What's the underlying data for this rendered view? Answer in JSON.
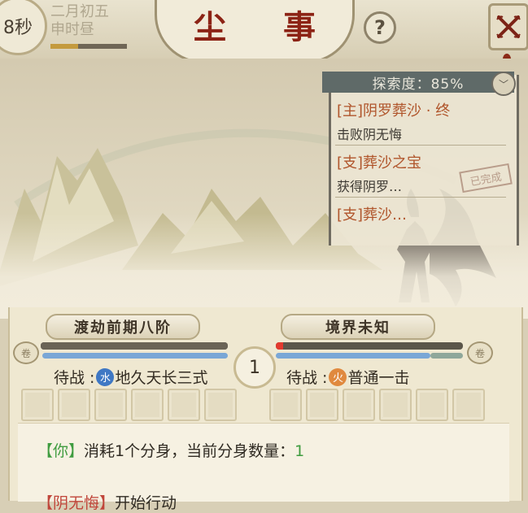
{
  "header": {
    "timer": "8秒",
    "date_line1": "二月初五",
    "date_line2": "申时昼",
    "time_progress": 0.36,
    "title": "尘 事",
    "help_symbol": "?"
  },
  "quest_panel": {
    "explore_label": "探索度：85%",
    "quests": [
      {
        "title": "[主]阴罗葬沙 · 终",
        "desc": "击败阴无悔"
      },
      {
        "title": "[支]葬沙之宝",
        "desc": "获得阴罗…",
        "stamp": "已完成"
      },
      {
        "title": "[支]葬沙…",
        "desc": ""
      }
    ]
  },
  "battle": {
    "player_realm": "渡劫前期八阶",
    "enemy_realm": "境界未知",
    "round": "1",
    "player_hp": 1.0,
    "enemy_hp": 0.04,
    "player_waiting_label": "待战 :",
    "player_element": "水",
    "player_skill": "地久天长三式",
    "enemy_waiting_label": "待战 :",
    "enemy_element": "火",
    "enemy_skill": "普通一击",
    "colors": {
      "water": "#3f78c4",
      "fire": "#e0893e",
      "hp_red": "#e23a2e",
      "bar_blue": "#7aa7d6"
    }
  },
  "log": {
    "line1_tag": "【你】",
    "line1_text": "消耗1个分身，当前分身数量：",
    "line1_value": "1",
    "line2_tag": "【阴无悔】",
    "line2_text": "开始行动"
  }
}
